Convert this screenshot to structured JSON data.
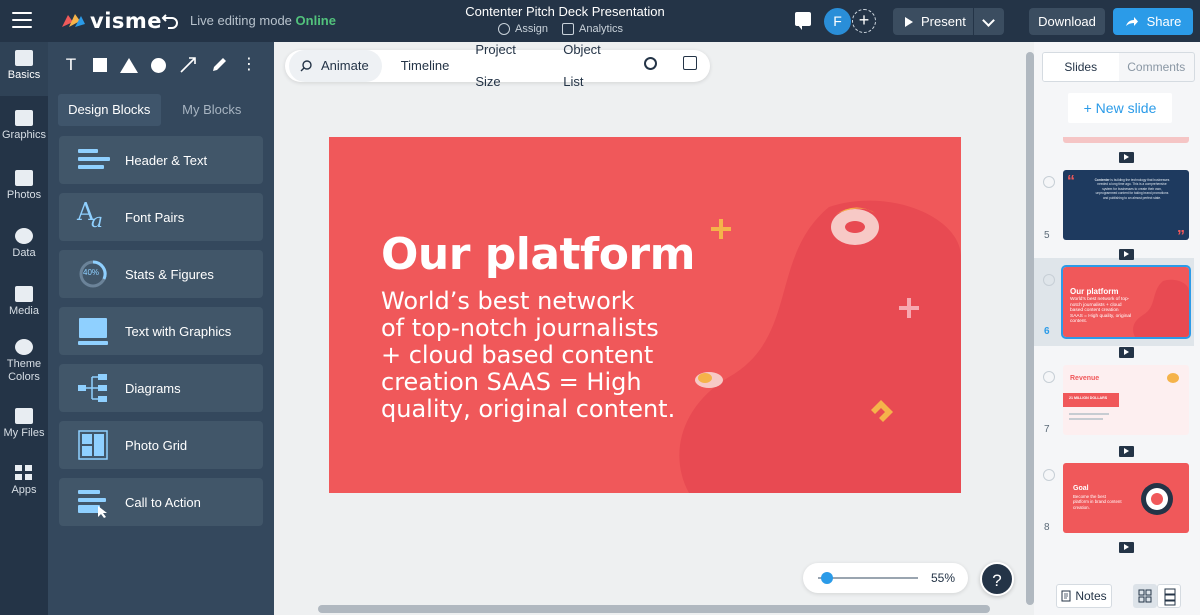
{
  "app": {
    "logo_text": "visme",
    "mode_label": "Live editing mode",
    "mode_status": "Online",
    "doc_title": "Contenter Pitch Deck Presentation",
    "assign_label": "Assign",
    "analytics_label": "Analytics",
    "avatar_initial": "F",
    "present_label": "Present",
    "download_label": "Download",
    "share_label": "Share"
  },
  "rail": [
    {
      "label": "Basics",
      "icon": "basics-icon"
    },
    {
      "label": "Graphics",
      "icon": "graphics-icon"
    },
    {
      "label": "Photos",
      "icon": "photos-icon"
    },
    {
      "label": "Data",
      "icon": "pie-chart-icon"
    },
    {
      "label": "Media",
      "icon": "media-icon"
    },
    {
      "label": "Theme Colors",
      "icon": "palette-icon"
    },
    {
      "label": "My Files",
      "icon": "folder-icon"
    },
    {
      "label": "Apps",
      "icon": "apps-icon"
    }
  ],
  "panel": {
    "tabs": [
      "Design Blocks",
      "My Blocks"
    ],
    "blocks": [
      {
        "label": "Header & Text",
        "icon": "header-text-icon"
      },
      {
        "label": "Font Pairs",
        "icon": "font-pairs-icon"
      },
      {
        "label": "Stats & Figures",
        "icon": "stats-icon",
        "icon_text": "40%"
      },
      {
        "label": "Text with Graphics",
        "icon": "text-graphics-icon"
      },
      {
        "label": "Diagrams",
        "icon": "diagram-icon"
      },
      {
        "label": "Photo Grid",
        "icon": "photo-grid-icon"
      },
      {
        "label": "Call to Action",
        "icon": "call-to-action-icon"
      }
    ]
  },
  "toolbar": {
    "animate": "Animate",
    "timeline": "Timeline",
    "project_size": "Project Size",
    "object_list": "Object List"
  },
  "slide": {
    "title": "Our platform",
    "body": "World’s best network\nof top-notch journalists\n+ cloud based content\ncreation SAAS = High\nquality, original content.",
    "colors": {
      "background": "#f0585a",
      "blob": "#e84a52",
      "accent": "#f5b34a"
    }
  },
  "zoom": {
    "value": "55%",
    "level": 0.05
  },
  "help_label": "?",
  "right": {
    "tabs": [
      "Slides",
      "Comments"
    ],
    "new_slide": "+ New slide",
    "slides": [
      {
        "num": "5",
        "title": "Contenter",
        "body": "is building the technology that businesses needed a long time ago. This is a comprehensive system for businesses to create their own, unprogrammed content for taking brand promotions and publishing to an almost perfect state."
      },
      {
        "num": "6",
        "title": "Our platform",
        "body": "World’s best network of top-notch journalists + cloud based content creation SAAS = High quality, original content."
      },
      {
        "num": "7",
        "title": "Revenue",
        "body": "21 MILLION DOLLARS"
      },
      {
        "num": "8",
        "title": "Goal",
        "body": "Become the best platform in brand content creation."
      }
    ],
    "notes_label": "Notes"
  }
}
